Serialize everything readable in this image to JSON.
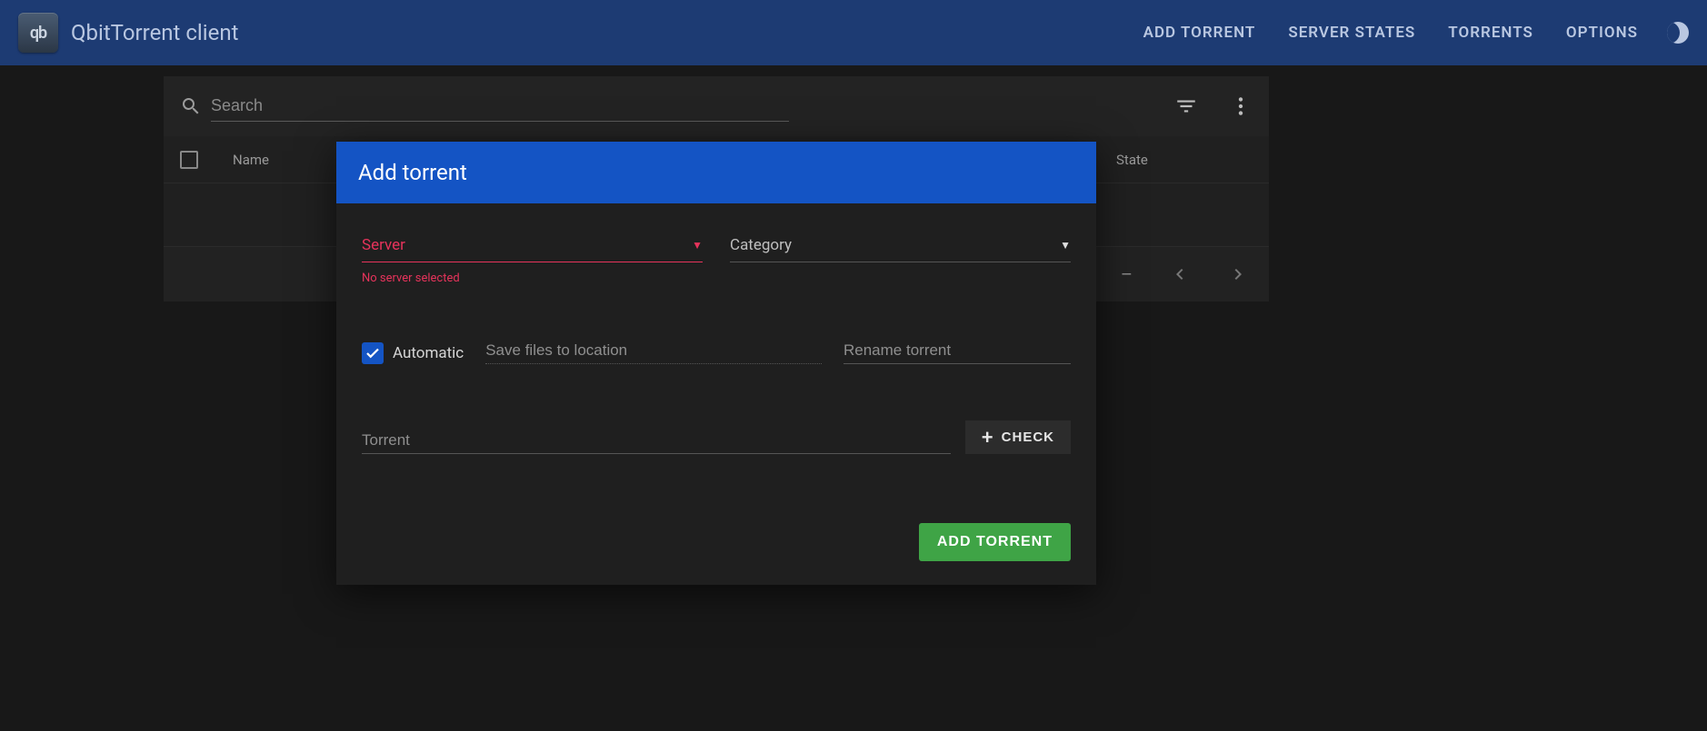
{
  "app": {
    "title": "QbitTorrent client",
    "logo_text": "qb"
  },
  "nav": {
    "add_torrent": "ADD TORRENT",
    "server_states": "SERVER STATES",
    "torrents": "TORRENTS",
    "options": "OPTIONS"
  },
  "toolbar": {
    "search_placeholder": "Search"
  },
  "table": {
    "columns": {
      "name": "Name",
      "state": "State"
    },
    "footer_dash": "–"
  },
  "dialog": {
    "title": "Add torrent",
    "server": {
      "label": "Server",
      "helper": "No server selected"
    },
    "category": {
      "label": "Category"
    },
    "automatic": {
      "label": "Automatic",
      "checked": true
    },
    "save_location": {
      "placeholder": "Save files to location"
    },
    "rename": {
      "placeholder": "Rename torrent"
    },
    "torrent": {
      "placeholder": "Torrent"
    },
    "check_btn": "CHECK",
    "submit_btn": "ADD TORRENT"
  },
  "colors": {
    "accent": "#1454c4",
    "error": "#e6335b",
    "success": "#3fa446"
  }
}
